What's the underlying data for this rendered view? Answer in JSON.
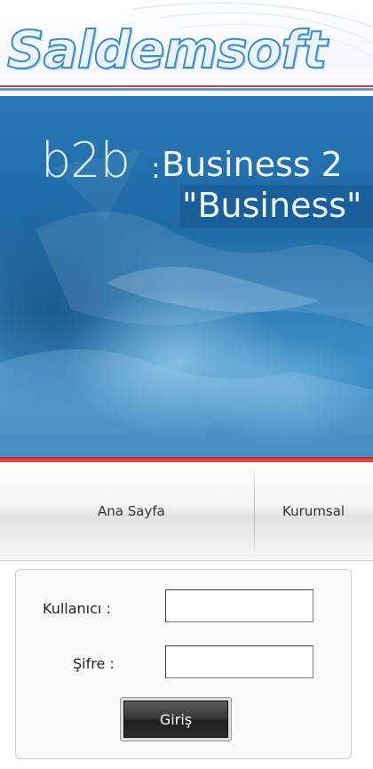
{
  "header": {
    "logo_text": "Saldemsoft"
  },
  "banner": {
    "b2b": "b2b",
    "colon": ":",
    "tagline_line1": "Business 2",
    "tagline_line2": "\"Business\""
  },
  "nav": {
    "items": [
      {
        "label": "Ana Sayfa"
      },
      {
        "label": "Kurumsal"
      }
    ]
  },
  "login": {
    "username_label": "Kullanıcı :",
    "username_value": "",
    "password_label": "Şifre :",
    "password_value": "",
    "submit_label": "Giriş"
  },
  "colors": {
    "brand_blue": "#3f8bc7",
    "accent_red": "#e04848",
    "banner_blue": "#2a78b4",
    "button_dark": "#2b2b2b"
  }
}
